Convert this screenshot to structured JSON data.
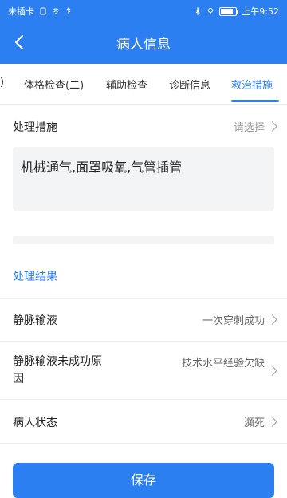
{
  "status_bar": {
    "left_text": "未插卡",
    "time": "上午9:52"
  },
  "header": {
    "title": "病人信息"
  },
  "tabs": [
    {
      "label": ")"
    },
    {
      "label": "体格检查(二)"
    },
    {
      "label": "辅助检查"
    },
    {
      "label": "诊断信息"
    },
    {
      "label": "救治措施"
    }
  ],
  "active_tab_index": 4,
  "measures": {
    "label": "处理措施",
    "placeholder": "请选择",
    "value": "机械通气,面罩吸氧,气管插管"
  },
  "results": {
    "section_title": "处理结果",
    "rows": [
      {
        "label": "静脉输液",
        "value": "一次穿刺成功"
      },
      {
        "label": "静脉输液未成功原因",
        "value": "技术水平经验欠缺"
      },
      {
        "label": "病人状态",
        "value": "濒死"
      }
    ]
  },
  "footer": {
    "button_label": "保存"
  },
  "colors": {
    "primary": "#2b7ff0",
    "text": "#222222",
    "muted": "#999999",
    "divider": "#eeeeee",
    "input_bg": "#f3f4f6"
  },
  "icons": {
    "back": "chevron-left-icon",
    "chevron": "chevron-right-icon",
    "wifi": "wifi-icon",
    "usb": "usb-icon",
    "bluetooth": "bluetooth-icon",
    "location": "location-icon",
    "battery": "battery-icon"
  },
  "battery_level": 0.8
}
